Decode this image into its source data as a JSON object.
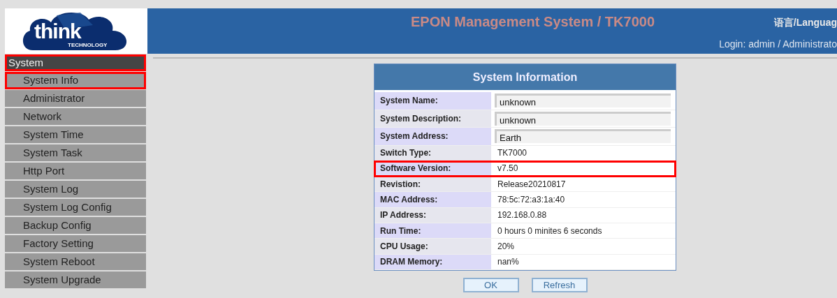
{
  "logo": {
    "text": "think",
    "subtext": "TECHNOLOGY"
  },
  "header": {
    "title": "EPON Management System / TK7000",
    "language": "语言/Languag",
    "login": "Login: admin / Administrato"
  },
  "sidebar": {
    "heading": {
      "label": "System",
      "highlighted": true
    },
    "items": [
      {
        "label": "System Info",
        "highlighted": true
      },
      {
        "label": "Administrator",
        "highlighted": false
      },
      {
        "label": "Network",
        "highlighted": false
      },
      {
        "label": "System Time",
        "highlighted": false
      },
      {
        "label": "System Task",
        "highlighted": false
      },
      {
        "label": "Http Port",
        "highlighted": false
      },
      {
        "label": "System Log",
        "highlighted": false
      },
      {
        "label": "System Log Config",
        "highlighted": false
      },
      {
        "label": "Backup Config",
        "highlighted": false
      },
      {
        "label": "Factory Setting",
        "highlighted": false
      },
      {
        "label": "System Reboot",
        "highlighted": false
      },
      {
        "label": "System Upgrade",
        "highlighted": false
      }
    ]
  },
  "panel": {
    "title": "System Information",
    "rows": [
      {
        "kind": "input",
        "label": "System Name:",
        "value": "unknown",
        "highlighted": false
      },
      {
        "kind": "input",
        "label": "System Description:",
        "value": "unknown",
        "highlighted": false
      },
      {
        "kind": "input",
        "label": "System Address:",
        "value": "Earth",
        "highlighted": false
      },
      {
        "kind": "text",
        "label": "Switch Type:",
        "value": "TK7000",
        "highlighted": false
      },
      {
        "kind": "text",
        "label": "Software Version:",
        "value": "v7.50",
        "highlighted": true
      },
      {
        "kind": "text",
        "label": "Revistion:",
        "value": "Release20210817",
        "highlighted": false
      },
      {
        "kind": "text",
        "label": "MAC Address:",
        "value": "78:5c:72:a3:1a:40",
        "highlighted": false
      },
      {
        "kind": "text",
        "label": "IP Address:",
        "value": "192.168.0.88",
        "highlighted": false
      },
      {
        "kind": "text",
        "label": "Run Time:",
        "value": "0 hours 0 minites 6 seconds",
        "highlighted": false
      },
      {
        "kind": "text",
        "label": "CPU Usage:",
        "value": "20%",
        "highlighted": false
      },
      {
        "kind": "text",
        "label": "DRAM Memory:",
        "value": "nan%",
        "highlighted": false
      }
    ],
    "buttons": [
      "OK",
      "Refresh"
    ]
  }
}
